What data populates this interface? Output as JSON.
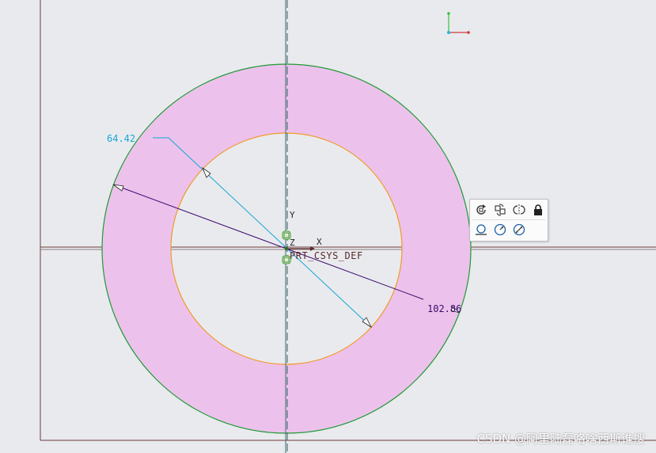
{
  "sketch": {
    "diameter_inner": "64.42",
    "diameter_outer": "102.86",
    "csys_label": "PRT_CSYS_DEF",
    "axis_y": "Y",
    "axis_x": "X",
    "axis_z": "Z"
  },
  "colors": {
    "ring_fill": "#ecc2ec",
    "outer_circle": "#1f9a34",
    "inner_circle": "#f19a27",
    "dim_inner": "#15a7d6",
    "dim_outer": "#3d0b6e",
    "centerline": "#3b6b6b",
    "reference_line": "#6b3a3a"
  },
  "toolbar": {
    "items": [
      {
        "icon": "rotate-icon",
        "title": "Rotate Resize"
      },
      {
        "icon": "replace-icon",
        "title": "Replace"
      },
      {
        "icon": "mirror-icon",
        "title": "Mirror"
      },
      {
        "icon": "lock-icon",
        "title": "Lock"
      },
      {
        "icon": "tangent-icon",
        "title": "Tangent"
      },
      {
        "icon": "radius-icon",
        "title": "Radius"
      },
      {
        "icon": "diameter-icon",
        "title": "Diameter"
      }
    ]
  },
  "watermark": "CSDN @阿里陆磊咯啥西斯谁搜"
}
